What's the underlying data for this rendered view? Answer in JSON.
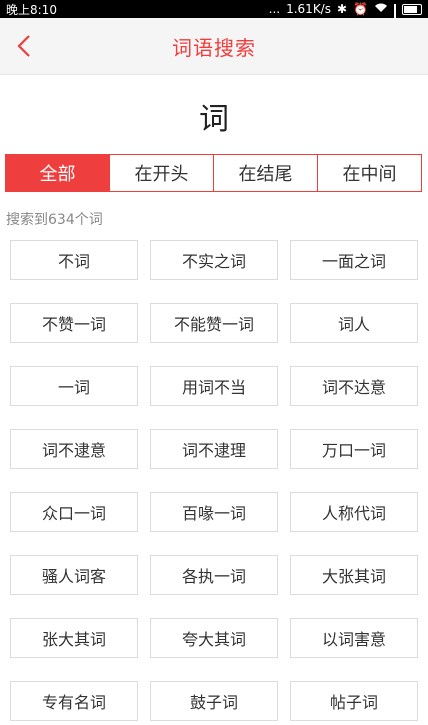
{
  "status_bar": {
    "time": "晚上8:10",
    "dots": "...",
    "speed": "1.61K/s",
    "bluetooth_icon": "bluetooth-icon",
    "colors": {
      "background": "#000000",
      "text": "#ffffff"
    }
  },
  "header": {
    "title": "词语搜索",
    "back_icon": "chevron-left-icon",
    "accent": "#ef3e3e"
  },
  "query": {
    "word": "词"
  },
  "tabs": [
    {
      "label": "全部",
      "active": true
    },
    {
      "label": "在开头",
      "active": false
    },
    {
      "label": "在结尾",
      "active": false
    },
    {
      "label": "在中间",
      "active": false
    }
  ],
  "result_count_text": "搜索到634个词",
  "results": [
    "不词",
    "不实之词",
    "一面之词",
    "不赞一词",
    "不能赞一词",
    "词人",
    "一词",
    "用词不当",
    "词不达意",
    "词不逮意",
    "词不逮理",
    "万口一词",
    "众口一词",
    "百喙一词",
    "人称代词",
    "骚人词客",
    "各执一词",
    "大张其词",
    "张大其词",
    "夸大其词",
    "以词害意",
    "专有名词",
    "鼓子词",
    "帖子词"
  ]
}
